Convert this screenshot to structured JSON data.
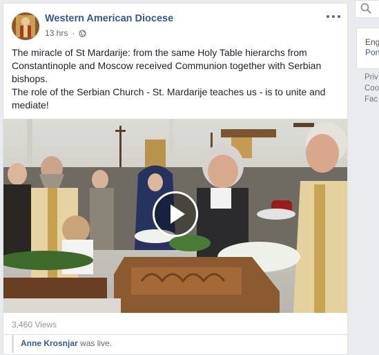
{
  "post": {
    "page_name": "Western American Diocese",
    "time": "13 hrs",
    "separator": "·",
    "privacy_icon": "globe-icon",
    "more_icon": "more-options-icon",
    "text_line1": "The miracle of St Mardarije: from the same Holy Table hierarchs from Constantinople and Moscow received Communion together with Serbian bishops.",
    "text_line2": "The role of the Serbian Church - St. Mardarije teaches us - is to unite and mediate!",
    "views": "3,460 Views",
    "shared_actor": "Anne Krosnjar",
    "shared_action": "was live."
  },
  "right_column": {
    "search_icon": "search-icon",
    "card_items": [
      "Eng",
      "Port"
    ],
    "footer_items": [
      "Priv",
      "Coo",
      "Fac"
    ]
  },
  "colors": {
    "link_blue": "#365899",
    "text": "#1d2129",
    "meta_gray": "#616770",
    "background": "#e9ebee"
  }
}
